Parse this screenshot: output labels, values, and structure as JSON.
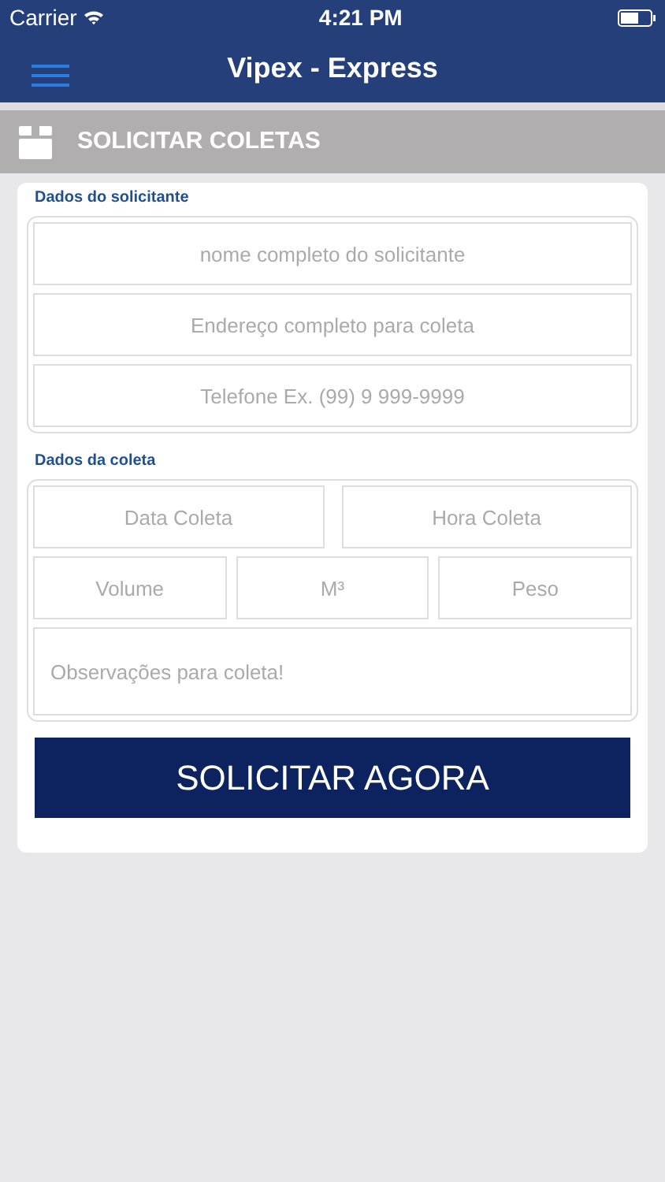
{
  "status_bar": {
    "carrier": "Carrier",
    "time": "4:21 PM"
  },
  "nav": {
    "title": "Vipex - Express"
  },
  "section_header": {
    "title": "SOLICITAR COLETAS"
  },
  "groups": [
    {
      "title": "Dados do solicitante",
      "fields": [
        {
          "kind": "full",
          "placeholder": "nome completo do solicitante"
        },
        {
          "kind": "full",
          "placeholder": "Endereço completo para coleta"
        },
        {
          "kind": "full",
          "placeholder": "Telefone Ex. (99) 9 999-9999"
        }
      ]
    },
    {
      "title": "Dados da coleta",
      "fields": [
        {
          "kind": "half",
          "placeholder": "Data Coleta"
        },
        {
          "kind": "half",
          "placeholder": "Hora Coleta"
        },
        {
          "kind": "third",
          "placeholder": "Volume"
        },
        {
          "kind": "third",
          "placeholder": "M³"
        },
        {
          "kind": "third",
          "placeholder": "Peso"
        },
        {
          "kind": "notes",
          "placeholder": "Observações para coleta!"
        }
      ]
    }
  ],
  "submit_button": "SOLICITAR AGORA"
}
